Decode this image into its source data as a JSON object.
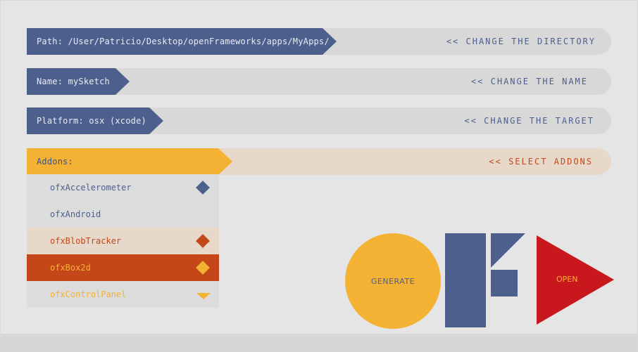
{
  "path": {
    "label": "Path: /User/Patricio/Desktop/openFrameworks/apps/MyApps/",
    "action": "<< CHANGE THE DIRECTORY"
  },
  "name": {
    "label": "Name: mySketch",
    "action": "<< CHANGE THE NAME"
  },
  "platform": {
    "label": "Platform: osx (xcode)",
    "action": "<< CHANGE THE TARGET"
  },
  "addons": {
    "label": "Addons:",
    "action": "<< SELECT ADDONS",
    "items": [
      {
        "label": "ofxAccelerometer",
        "state": "checked"
      },
      {
        "label": "ofxAndroid",
        "state": "none"
      },
      {
        "label": "ofxBlobTracker",
        "state": "hover"
      },
      {
        "label": "ofxBox2d",
        "state": "selected"
      },
      {
        "label": "ofxControlPanel",
        "state": "faded"
      }
    ]
  },
  "buttons": {
    "generate": "GENERATE",
    "open": "OPEN"
  },
  "colors": {
    "blue": "#4d5f8c",
    "yellow": "#f4b235",
    "orange": "#c4471a",
    "red": "#c9171e"
  },
  "icons": {
    "logo": "openframeworks-logo-icon",
    "checked": "diamond-icon",
    "more": "triangle-down-icon"
  }
}
